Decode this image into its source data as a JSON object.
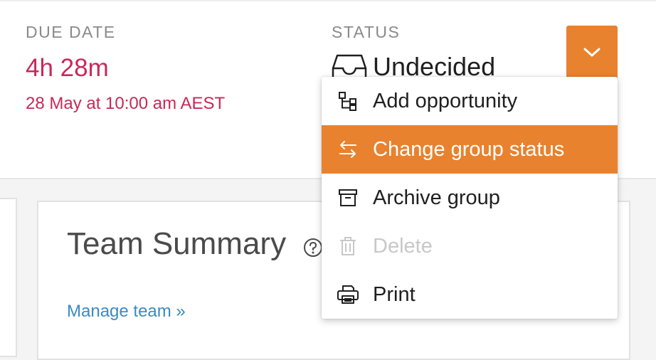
{
  "due": {
    "label": "DUE DATE",
    "remaining": "4h 28m",
    "datetime": "28 May at 10:00 am AEST"
  },
  "status": {
    "label": "STATUS",
    "value": "Undecided",
    "icon": "inbox-tray-icon"
  },
  "dropdown": {
    "icon": "chevron-down-icon",
    "color": "#e8822e"
  },
  "menu": {
    "items": [
      {
        "label": "Add opportunity",
        "icon": "hierarchy-icon",
        "state": "normal"
      },
      {
        "label": "Change group status",
        "icon": "swap-arrows-icon",
        "state": "active"
      },
      {
        "label": "Archive group",
        "icon": "archive-box-icon",
        "state": "normal"
      },
      {
        "label": "Delete",
        "icon": "trash-icon",
        "state": "disabled"
      },
      {
        "label": "Print",
        "icon": "printer-icon",
        "state": "normal"
      }
    ]
  },
  "team_summary": {
    "title": "Team Summary",
    "help_icon": "help-icon",
    "manage_link": "Manage team »"
  },
  "colors": {
    "accent": "#e8822e",
    "due": "#c8285a",
    "link": "#3b8ac4",
    "disabled": "#c8c8c8"
  }
}
